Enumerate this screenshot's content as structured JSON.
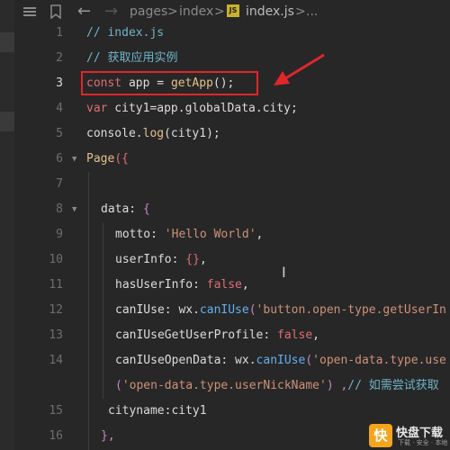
{
  "breadcrumb": {
    "items": [
      "pages",
      "index",
      "index.js",
      "..."
    ],
    "separator": ">",
    "file_badge": "JS"
  },
  "gutter": {
    "line_numbers": [
      "1",
      "2",
      "3",
      "4",
      "5",
      "6",
      "7",
      "8",
      "9",
      "10",
      "11",
      "12",
      "13",
      "14",
      "",
      "15",
      "16"
    ],
    "active_line": "3"
  },
  "code": {
    "l1": "// index.js",
    "l2": "// 获取应用实例",
    "l3_kw": "const",
    "l3_var": " app = ",
    "l3_fn": "getApp",
    "l3_end": "();",
    "l4_kw": "var",
    "l4_rest": " city1=app.globalData.city;",
    "l5_obj": "console.",
    "l5_fn": "log",
    "l5_rest": "(city1);",
    "l6_fn": "Page",
    "l6_rest": "({",
    "l8_prop": "data: ",
    "l8_brace": "{",
    "l9_prop": "motto: ",
    "l9_str": "'Hello World'",
    "l9_end": ",",
    "l10_prop": "userInfo: ",
    "l10_brace": "{}",
    "l10_end": ",",
    "l11_prop": "hasUserInfo: ",
    "l11_bool": "false",
    "l11_end": ",",
    "l12_prop": "canIUse: wx.",
    "l12_fn": "canIUse",
    "l12_open": "(",
    "l12_str": "'button.open-type.getUserIn",
    "l13_prop": "canIUseGetUserProfile: ",
    "l13_bool": "false",
    "l13_end": ",",
    "l14_prop": "canIUseOpenData: wx.",
    "l14_fn": "canIUse",
    "l14_open": "(",
    "l14_str": "'open-data.type.use",
    "l14w_open": "(",
    "l14w_str": "'open-data.type.userNickName'",
    "l14w_close": ") ,",
    "l14w_cm": "// 如需尝试获取",
    "l15": "cityname:city1",
    "l16": "},"
  },
  "watermark": {
    "mark": "快",
    "name": "快盘下载",
    "sub": "下载 · 安全 · 本地"
  }
}
